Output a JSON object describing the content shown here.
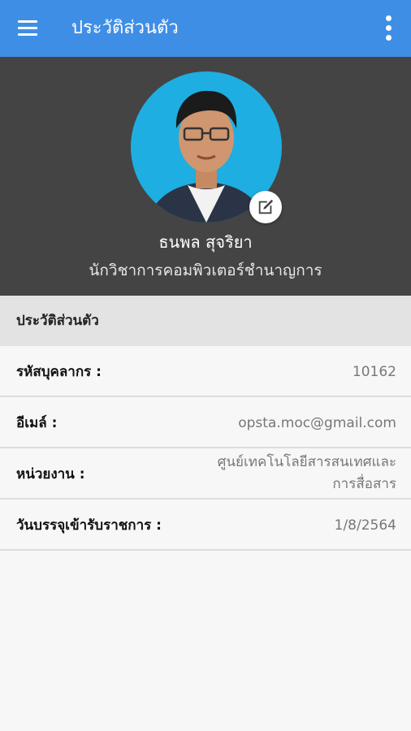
{
  "appbar": {
    "title": "ประวัติส่วนตัว",
    "menu_icon": "hamburger-menu-icon",
    "more_icon": "more-vertical-icon",
    "color": "#3f8ee6"
  },
  "profile": {
    "name": "ธนพล สุจริยา",
    "position": "นักวิชาการคอมพิวเตอร์ชำนาญการ",
    "avatar_bg": "#1eaee2",
    "edit_icon": "edit-icon"
  },
  "section": {
    "title": "ประวัติส่วนตัว"
  },
  "info": [
    {
      "label": "รหัสบุคลากร :",
      "value": "10162"
    },
    {
      "label": "อีเมล์ :",
      "value": "opsta.moc@gmail.com"
    },
    {
      "label": "หน่วยงาน :",
      "value_line1": "ศูนย์เทคโนโลยีสารสนเทศและ",
      "value_line2": "การสื่อสาร"
    },
    {
      "label": "วันบรรจุเข้ารับราชการ :",
      "value": "1/8/2564"
    }
  ]
}
